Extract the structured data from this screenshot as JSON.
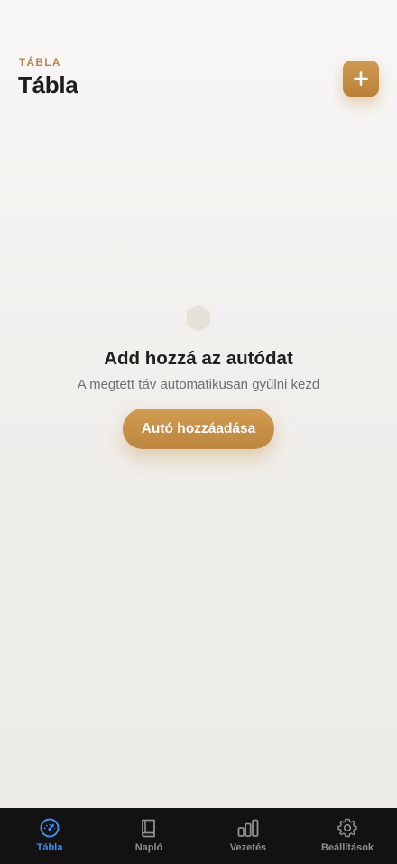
{
  "header": {
    "eyebrow": "TÁBLA",
    "title": "Tábla",
    "add_icon": "plus-icon"
  },
  "empty_state": {
    "icon": "hexagon-icon",
    "title": "Add hozzá az autódat",
    "subtitle": "A megtett táv automatikusan gyűlni kezd",
    "button_label": "Autó hozzáadása"
  },
  "tabbar": {
    "items": [
      {
        "label": "Tábla",
        "icon": "speedometer-icon",
        "active": true
      },
      {
        "label": "Napló",
        "icon": "book-icon",
        "active": false
      },
      {
        "label": "Vezetés",
        "icon": "bar-chart-icon",
        "active": false
      },
      {
        "label": "Beállítások",
        "icon": "gear-icon",
        "active": false
      }
    ]
  },
  "colors": {
    "accent": "#c48d44",
    "active_tab": "#3f8ef5",
    "inactive_tab": "#8e8e93",
    "tabbar_bg": "#121212"
  }
}
